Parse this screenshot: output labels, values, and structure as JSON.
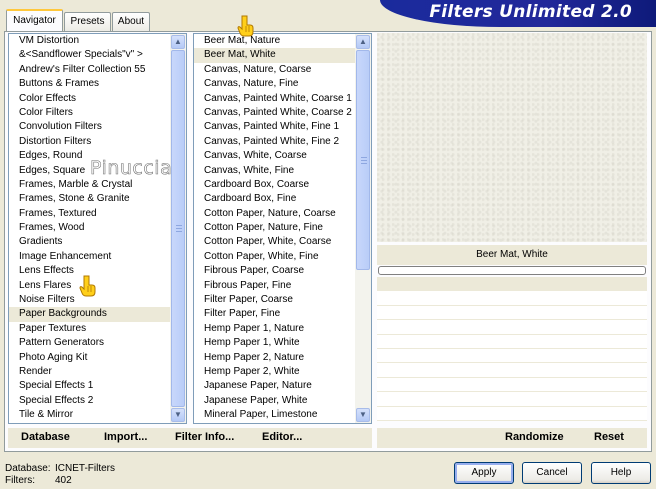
{
  "tabs": [
    "Navigator",
    "Presets",
    "About"
  ],
  "banner_title": "Filters Unlimited 2.0",
  "categories": [
    "VM Distortion",
    "&<Sandflower Specials\"v\" >",
    "Andrew's Filter Collection 55",
    "Buttons & Frames",
    "Color Effects",
    "Color Filters",
    "Convolution Filters",
    "Distortion Filters",
    "Edges, Round",
    "Edges, Square",
    "Frames, Marble & Crystal",
    "Frames, Stone & Granite",
    "Frames, Textured",
    "Frames, Wood",
    "Gradients",
    "Image Enhancement",
    "Lens Effects",
    "Lens Flares",
    "Noise Filters",
    "Paper Backgrounds",
    "Paper Textures",
    "Pattern Generators",
    "Photo Aging Kit",
    "Render",
    "Special Effects 1",
    "Special Effects 2",
    "Tile & Mirror"
  ],
  "selected_category": "Paper Backgrounds",
  "filters": [
    "Beer Mat, Nature",
    "Beer Mat, White",
    "Canvas, Nature, Coarse",
    "Canvas, Nature, Fine",
    "Canvas, Painted White, Coarse 1",
    "Canvas, Painted White, Coarse 2",
    "Canvas, Painted White, Fine 1",
    "Canvas, Painted White, Fine 2",
    "Canvas, White, Coarse",
    "Canvas, White, Fine",
    "Cardboard Box, Coarse",
    "Cardboard Box, Fine",
    "Cotton Paper, Nature, Coarse",
    "Cotton Paper, Nature, Fine",
    "Cotton Paper, White, Coarse",
    "Cotton Paper, White, Fine",
    "Fibrous Paper, Coarse",
    "Fibrous Paper, Fine",
    "Filter Paper, Coarse",
    "Filter Paper, Fine",
    "Hemp Paper 1, Nature",
    "Hemp Paper 1, White",
    "Hemp Paper 2, Nature",
    "Hemp Paper 2, White",
    "Japanese Paper, Nature",
    "Japanese Paper, White",
    "Mineral Paper, Limestone"
  ],
  "selected_filter": "Beer Mat, White",
  "preview_title": "Beer Mat, White",
  "toolbar": {
    "database": "Database",
    "import": "Import...",
    "filter_info": "Filter Info...",
    "editor": "Editor...",
    "randomize": "Randomize",
    "reset": "Reset"
  },
  "status": {
    "database_label": "Database:",
    "database_value": "ICNET-Filters",
    "filters_label": "Filters:",
    "filters_value": "402"
  },
  "buttons": {
    "apply": "Apply",
    "cancel": "Cancel",
    "help": "Help"
  },
  "watermark": "Pinuccia",
  "colors": {
    "banner": "#22289a",
    "selection": "#ece9d8",
    "list_border": "#7f9db9"
  }
}
